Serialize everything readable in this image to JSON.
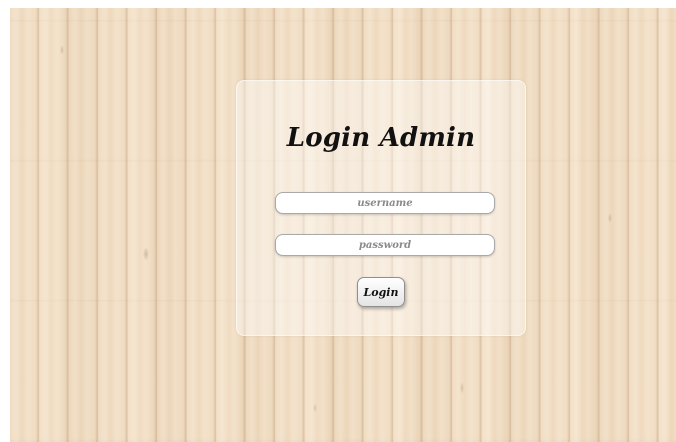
{
  "login_form": {
    "title": "Login Admin",
    "username": {
      "value": "",
      "placeholder": "username"
    },
    "password": {
      "value": "",
      "placeholder": "password"
    },
    "submit_label": "Login"
  },
  "colors": {
    "background_wood": "#f0dcc1",
    "card": "#ffffff",
    "text": "#111111",
    "placeholder": "#8a8a8a",
    "field_border": "#a9a9a9"
  }
}
